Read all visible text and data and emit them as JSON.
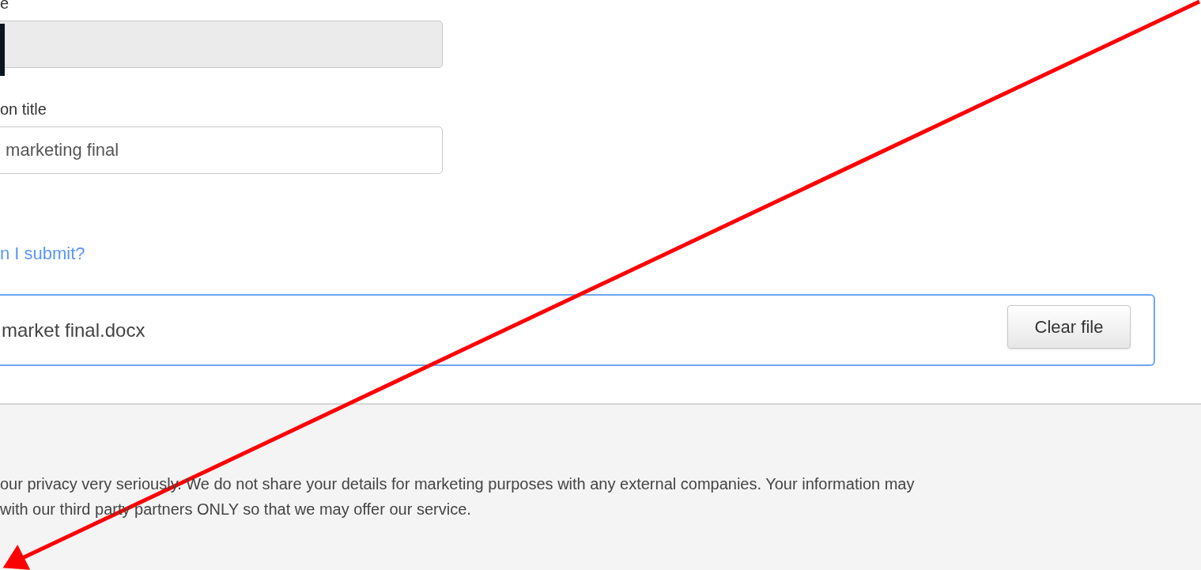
{
  "fields": [
    {
      "label": "e",
      "disabled": true,
      "cursor": true
    },
    {
      "label": "on title",
      "value": " marketing final",
      "disabled": false
    }
  ],
  "help_link": "n I submit?",
  "file": {
    "name": "market final.docx",
    "button": "Clear file"
  },
  "footer": {
    "lines": [
      "our privacy very seriously. We do not share your details for marketing purposes with any external companies. Your information may",
      "with our third party partners ONLY so that we may offer our service."
    ]
  },
  "annotation": {
    "kind": "arrow"
  }
}
